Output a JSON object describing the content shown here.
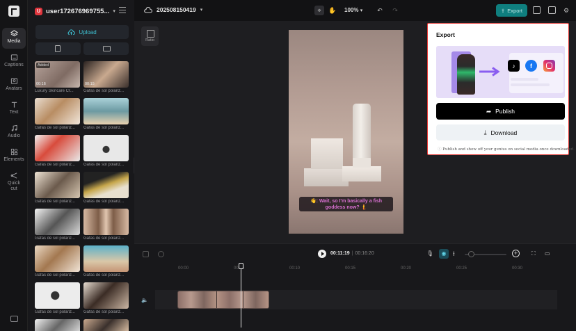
{
  "nav": {
    "items": [
      {
        "label": "Media",
        "icon": "media-icon",
        "active": true
      },
      {
        "label": "Captions",
        "icon": "captions-icon"
      },
      {
        "label": "Avatars",
        "icon": "avatars-icon"
      },
      {
        "label": "Text",
        "icon": "text-icon"
      },
      {
        "label": "Audio",
        "icon": "audio-icon"
      },
      {
        "label": "Elements",
        "icon": "elements-icon"
      },
      {
        "label": "Quick cut",
        "icon": "quick-cut-icon"
      }
    ]
  },
  "media": {
    "username": "user172676969755...",
    "user_badge": "U",
    "upload_label": "Upload",
    "thumbs": [
      {
        "caption": "Luxury Skincare Cr...",
        "badge": "Added",
        "duration": "00:16"
      },
      {
        "caption": "Gafas de sol polariz...",
        "duration": "00:15"
      },
      {
        "caption": "Gafas de sol polariz..."
      },
      {
        "caption": "Gafas de sol polariz..."
      },
      {
        "caption": "Gafas de sol polariz..."
      },
      {
        "caption": "Gafas de sol polariz..."
      },
      {
        "caption": "Gafas de sol polariz..."
      },
      {
        "caption": "Gafas de sol polariz..."
      },
      {
        "caption": "Gafas de sol polariz..."
      },
      {
        "caption": "Gafas de sol polariz..."
      },
      {
        "caption": "Gafas de sol polariz..."
      },
      {
        "caption": "Gafas de sol polariz..."
      },
      {
        "caption": "Gafas de sol polariz..."
      },
      {
        "caption": "Gafas de sol polariz..."
      },
      {
        "caption": ""
      },
      {
        "caption": ""
      }
    ]
  },
  "topbar": {
    "project_name": "202508150419",
    "zoom": "100%",
    "export_label": "Export"
  },
  "canvas": {
    "ratio_label": "Ratio",
    "caption_line1": "👋: Wait, so I'm basically a fish",
    "caption_line2": "goddess now? 🧜"
  },
  "export_panel": {
    "title": "Export",
    "publish_label": "Publish",
    "download_label": "Download",
    "note": "Publish and show off your genius on social media once downloaded."
  },
  "timeline": {
    "current_time": "00:11:19",
    "separator": "|",
    "total_time": "00:16:20",
    "ruler": [
      "00:00",
      "00:05",
      "00:10",
      "00:15",
      "00:20",
      "00:25",
      "00:30"
    ]
  },
  "colors": {
    "accent": "#0f7f7f",
    "upload_text": "#3ec1d3",
    "highlight_border": "#e53935"
  }
}
